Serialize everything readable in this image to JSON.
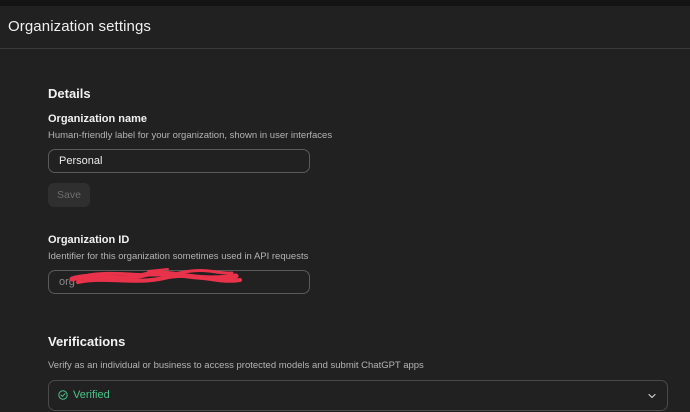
{
  "header": {
    "title": "Organization settings"
  },
  "details": {
    "section_title": "Details",
    "org_name": {
      "label": "Organization name",
      "help": "Human-friendly label for your organization, shown in user interfaces",
      "value": "Personal"
    },
    "save_label": "Save",
    "org_id": {
      "label": "Organization ID",
      "help": "Identifier for this organization sometimes used in API requests",
      "value_visible_prefix": "org"
    }
  },
  "verifications": {
    "section_title": "Verifications",
    "help": "Verify as an individual or business to access protected models and submit ChatGPT apps",
    "status": "Verified",
    "status_color": "#4cc38a"
  },
  "colors": {
    "background": "#212121",
    "redaction": "#e8334a"
  }
}
